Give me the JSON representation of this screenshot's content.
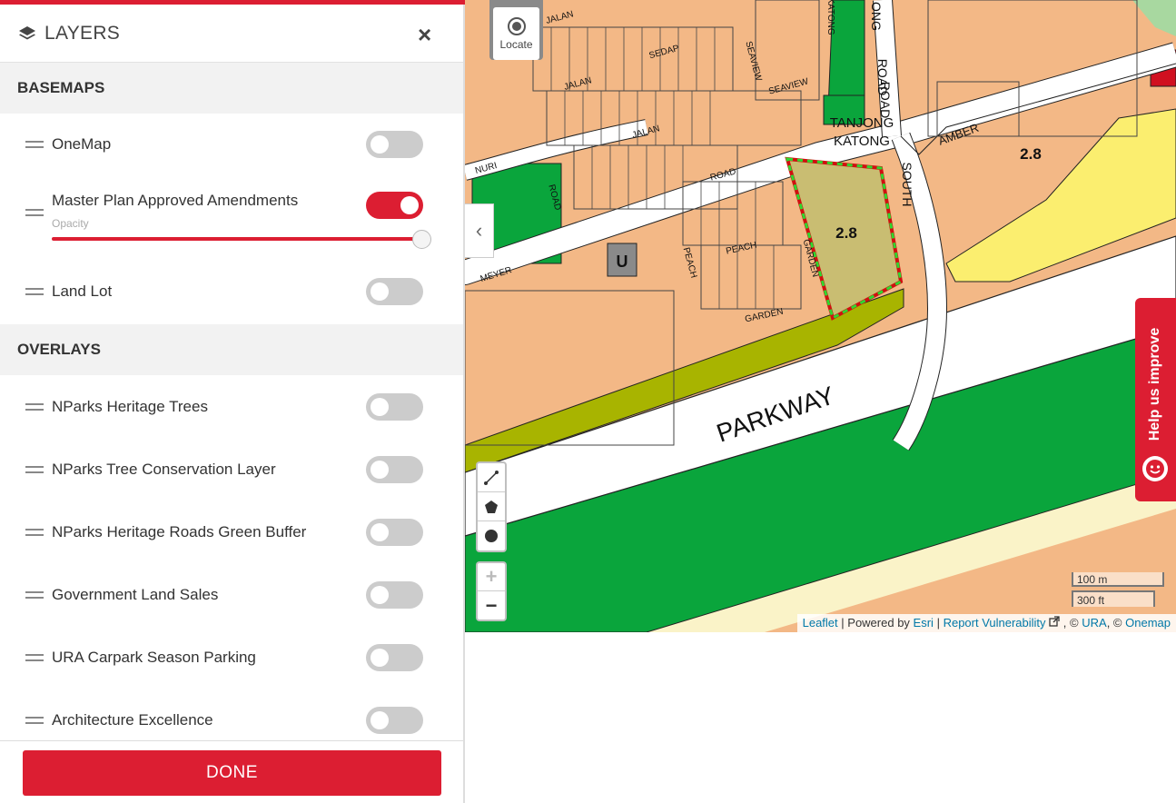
{
  "panel": {
    "title": "LAYERS",
    "close_label": "×",
    "basemaps_heading": "BASEMAPS",
    "overlays_heading": "OVERLAYS",
    "basemaps": [
      {
        "label": "OneMap",
        "enabled": false
      },
      {
        "label": "Master Plan Approved Amendments",
        "enabled": true,
        "opacity_label": "Opacity",
        "opacity": 1.0
      },
      {
        "label": "Land Lot",
        "enabled": false
      }
    ],
    "overlays": [
      {
        "label": "NParks Heritage Trees",
        "enabled": false
      },
      {
        "label": "NParks Tree Conservation Layer",
        "enabled": false
      },
      {
        "label": "NParks Heritage Roads Green Buffer",
        "enabled": false
      },
      {
        "label": "Government Land Sales",
        "enabled": false
      },
      {
        "label": "URA Carpark Season Parking",
        "enabled": false
      },
      {
        "label": "Architecture Excellence",
        "enabled": false
      }
    ],
    "done_label": "DONE"
  },
  "map": {
    "locate_label": "Locate",
    "collapse_glyph": "‹",
    "zoom_in": "+",
    "zoom_out": "−",
    "scale_metric": "100 m",
    "scale_imperial": "300 ft",
    "attribution": {
      "leaflet": "Leaflet",
      "powered_by": "| Powered by",
      "esri": "Esri",
      "sep": "|",
      "report": "Report Vulnerability",
      "copy1": ", ©",
      "ura": "URA",
      "copy2": ", ©",
      "onemap": "Onemap"
    },
    "help_label": "Help us improve",
    "plot_ratio_label": "2.8",
    "plot_ratio_label_2": "2.8",
    "road_labels": {
      "parkway": "PARKWAY",
      "amber": "AMBER",
      "tanjong": "TANJONG",
      "katong": "KATONG",
      "road": "ROAD",
      "south": "SOUTH",
      "jalan1": "JALAN",
      "jalan2": "JALAN",
      "jalan3": "JALAN",
      "sedap": "SEDAP",
      "seaview1": "SEAVIEW",
      "seaview2": "SEAVIEW",
      "nuri": "NURI",
      "nuri_road": "ROAD",
      "road2": "ROAD",
      "meyer": "MEYER",
      "peach1": "PEACH",
      "peach2": "PEACH",
      "garden1": "GARDEN",
      "garden2": "GARDEN",
      "katong_v": "KATONG",
      "ong": "ONG",
      "road3": "ROAD",
      "u_label": "U"
    },
    "colors": {
      "residential": "#f3b886",
      "park": "#0aa53c",
      "road": "#ffffff",
      "commercial": "#fbee6f",
      "olive": "#a8b400",
      "beach": "#faf3c8",
      "highlight_fill": "#c9bd72",
      "accent": "#dc1e32"
    }
  }
}
